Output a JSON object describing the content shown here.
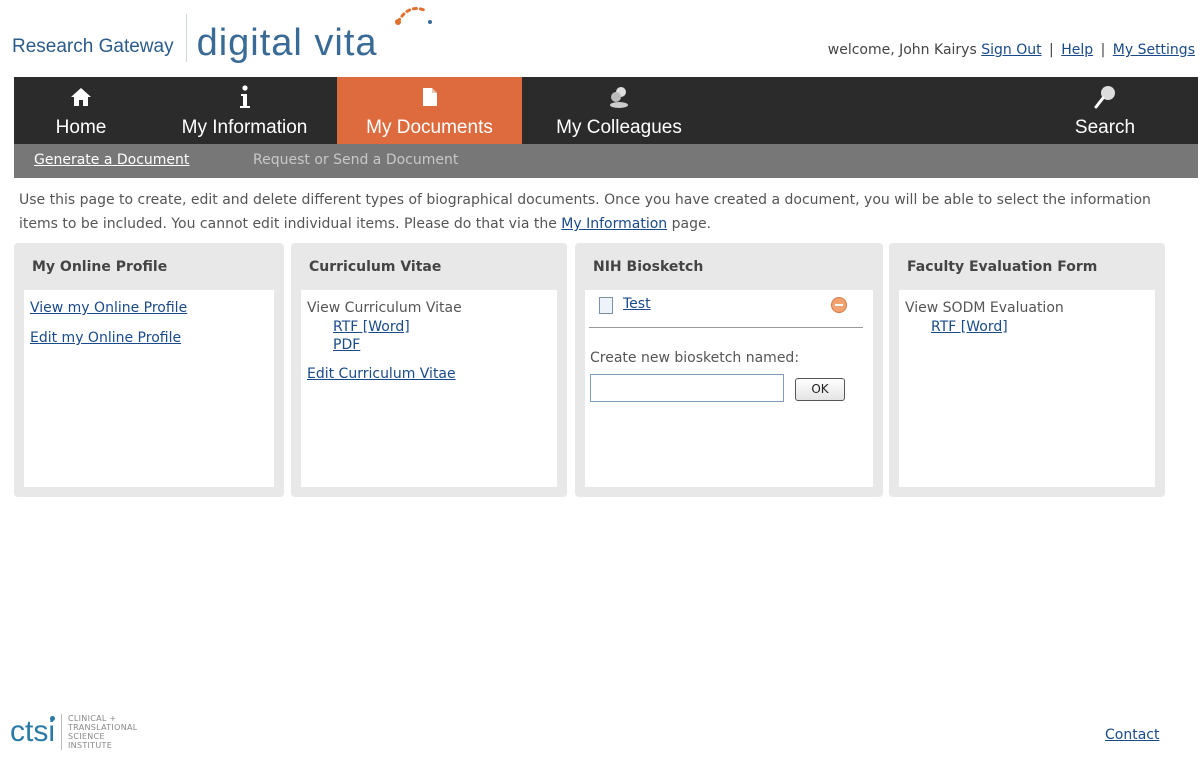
{
  "brand": {
    "gateway": "Research Gateway",
    "product": "digital vita"
  },
  "user_bar": {
    "welcome": "welcome, John Kairys",
    "sign_out": "Sign Out",
    "help": "Help",
    "settings": "My Settings",
    "separator": "|"
  },
  "nav": {
    "items": [
      {
        "label": "Home",
        "icon": "home-icon",
        "active": false
      },
      {
        "label": "My Information",
        "icon": "info-icon",
        "active": false
      },
      {
        "label": "My Documents",
        "icon": "document-icon",
        "active": true
      },
      {
        "label": "My Colleagues",
        "icon": "people-icon",
        "active": false
      },
      {
        "label": "Search",
        "icon": "magnifier-icon",
        "active": false
      }
    ],
    "active_color": "#dd6b3d",
    "bar_color": "#2b2b2b"
  },
  "subnav": {
    "items": [
      {
        "label": "Generate a Document",
        "active": true
      },
      {
        "label": "Request or Send a Document",
        "active": false
      }
    ]
  },
  "intro": {
    "text_before": "Use this page to create, edit and delete different types of biographical documents. Once you have created a document, you will be able to select the information items to be included. You cannot edit individual items. Please do that via the ",
    "link": "My Information",
    "text_after": " page."
  },
  "panels": {
    "profile": {
      "title": "My Online Profile",
      "view_link": "View my Online Profile",
      "edit_link": "Edit my Online Profile"
    },
    "cv": {
      "title": "Curriculum Vitae",
      "view_label": "View Curriculum Vitae",
      "rtf_link": "RTF [Word]",
      "pdf_link": "PDF",
      "edit_link": "Edit Curriculum Vitae"
    },
    "nih": {
      "title": "NIH Biosketch",
      "doc_name": "Test",
      "create_label": "Create new biosketch named:",
      "input_value": "",
      "ok_label": "OK"
    },
    "faculty": {
      "title": "Faculty Evaluation Form",
      "view_label": "View SODM Evaluation",
      "rtf_link": "RTF [Word]"
    }
  },
  "footer": {
    "ctsi_word": "ctsi",
    "ctsi_lines": [
      "CLINICAL +",
      "TRANSLATIONAL",
      "SCIENCE",
      "INSTITUTE"
    ],
    "contact": "Contact"
  }
}
